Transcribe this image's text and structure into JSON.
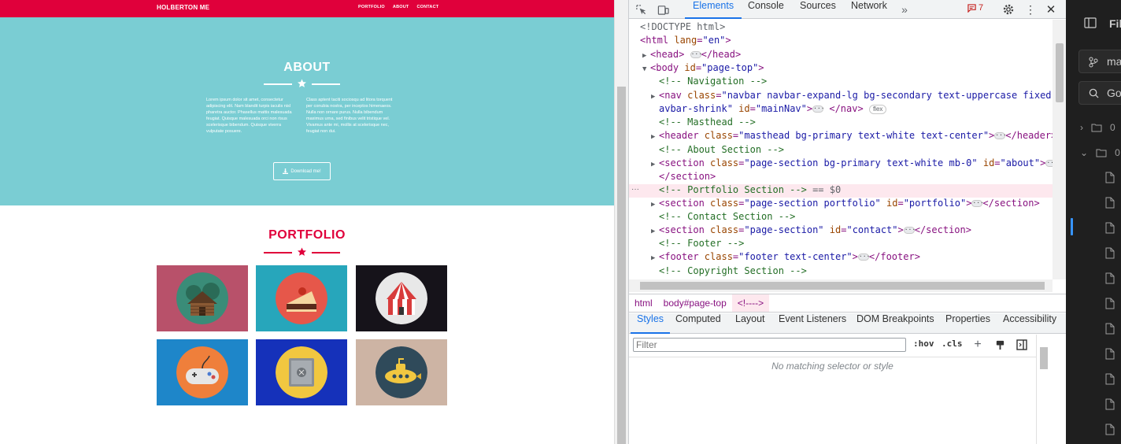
{
  "site": {
    "brand": "HOLBERTON ME",
    "nav": [
      "PORTFOLIO",
      "ABOUT",
      "CONTACT"
    ],
    "about_title": "ABOUT",
    "about_left": "Lorem ipsum dolor sit amet, consectetur adipiscing elit. Nam blandit turpis iaculis nisl pharetra auctor. Phasellus mattis malesuada feugiat. Quisque malesuada orci non risus scelerisque bibendum. Quisque viverra vulputate posuere.",
    "about_right": "Class aptent taciti sociosqu ad litora torquent per conubia nostra, per inceptos himenaeos. Nulla non ornare purus. Nulla bibendum maximus urna, sed finibus velit tristique vel. Vivamus ante mi, mollis at scelerisque nec, feugiat non dui.",
    "download_label": "Download me!",
    "portfolio_title": "PORTFOLIO",
    "tiles": [
      {
        "name": "cabin",
        "bg": "#b8516a",
        "circle": "#3a8c78"
      },
      {
        "name": "cake",
        "bg": "#27a6bb",
        "circle": "#e6574a"
      },
      {
        "name": "circus",
        "bg": "#16131a",
        "circle": "#e8e8e8"
      },
      {
        "name": "game",
        "bg": "#1e86c9",
        "circle": "#ef7f3b"
      },
      {
        "name": "safe",
        "bg": "#1531ba",
        "circle": "#f1c740"
      },
      {
        "name": "submarine",
        "bg": "#cdb4a4",
        "circle": "#2f4a5a"
      }
    ]
  },
  "devtools": {
    "tabs": [
      "Elements",
      "Console",
      "Sources",
      "Network"
    ],
    "issues_count": "7",
    "crumbs": [
      "html",
      "body#page-top",
      "<!---->"
    ],
    "style_tabs": [
      "Styles",
      "Computed",
      "Layout",
      "Event Listeners",
      "DOM Breakpoints",
      "Properties",
      "Accessibility"
    ],
    "filter_placeholder": "Filter",
    "hov": ":hov",
    "cls": ".cls",
    "no_match": "No matching selector or style"
  },
  "editor": {
    "title": "Fil",
    "branch": "ma",
    "search": "Go",
    "folders": [
      "0",
      "0"
    ]
  },
  "colors": {
    "accent": "#e0003b",
    "teal": "#7acdd3",
    "devtools_blue": "#1a73e8"
  }
}
